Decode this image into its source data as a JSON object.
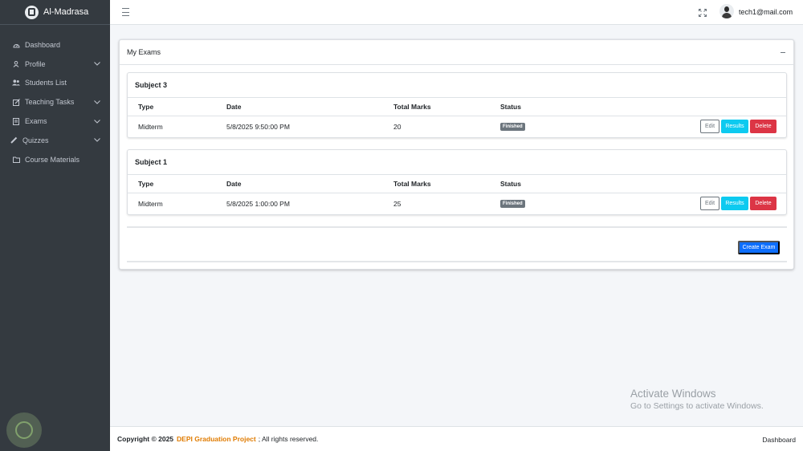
{
  "brand": {
    "name": "Al-Madrasa"
  },
  "sidebar": {
    "items": [
      {
        "label": "Dashboard",
        "icon": "dashboard-icon",
        "has_children": false
      },
      {
        "label": "Profile",
        "icon": "user-icon",
        "has_children": true
      },
      {
        "label": "Students List",
        "icon": "users-icon",
        "has_children": false
      },
      {
        "label": "Teaching Tasks",
        "icon": "edit-icon",
        "has_children": true
      },
      {
        "label": "Exams",
        "icon": "document-icon",
        "has_children": true
      },
      {
        "label": "Quizzes",
        "icon": "pencil-icon",
        "has_children": true
      },
      {
        "label": "Course Materials",
        "icon": "folder-icon",
        "has_children": false
      }
    ]
  },
  "topbar": {
    "user_email": "tech1@mail.com"
  },
  "main": {
    "title": "My Exams",
    "columns": [
      "Type",
      "Date",
      "Total Marks",
      "Status"
    ],
    "subjects": [
      {
        "name": "Subject 3",
        "exams": [
          {
            "type": "Midterm",
            "date": "5/8/2025 9:50:00 PM",
            "total_marks": "20",
            "status": "Finished"
          }
        ]
      },
      {
        "name": "Subject 1",
        "exams": [
          {
            "type": "Midterm",
            "date": "5/8/2025 1:00:00 PM",
            "total_marks": "25",
            "status": "Finished"
          }
        ]
      }
    ],
    "actions": {
      "edit": "Edit",
      "results": "Results",
      "delete": "Delete"
    },
    "create_label": "Create Exam"
  },
  "os_watermark": {
    "title": "Activate Windows",
    "subtitle": "Go to Settings to activate Windows."
  },
  "footer": {
    "copyright": "Copyright © 2025",
    "project_link": "DEPI Graduation Project",
    "rights": "; All rights reserved.",
    "right_link": "Dashboard"
  },
  "colors": {
    "sidebar_bg": "#343a40",
    "primary": "#0d6efd",
    "info": "#0dcaf0",
    "danger": "#dc3545",
    "secondary": "#6c757d",
    "footer_link": "#e07b00"
  }
}
